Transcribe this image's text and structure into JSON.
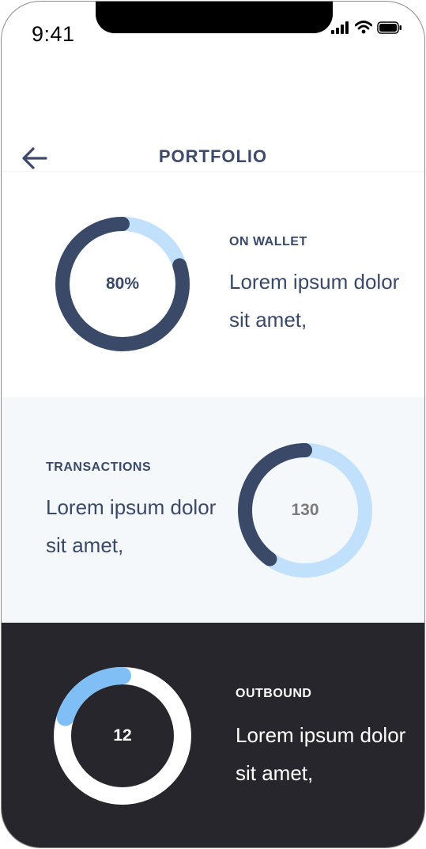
{
  "status_bar": {
    "time": "9:41",
    "icons": [
      "cellular-signal-icon",
      "wifi-icon",
      "battery-icon"
    ]
  },
  "header": {
    "title": "PORTFOLIO",
    "back_icon": "arrow-left-icon"
  },
  "cards": {
    "wallet": {
      "label": "ON WALLET",
      "text": "Lorem ipsum dolor sit amet,",
      "value": "80%",
      "progress": 0.8,
      "track_color": "#c1e0fb",
      "fill_color": "#3a4968",
      "value_color": "#3a4968",
      "text_color": "#3a4968"
    },
    "transactions": {
      "label": "TRANSACTIONS",
      "text": "Lorem ipsum dolor sit amet,",
      "value": "130",
      "progress": 0.4,
      "track_color": "#c1e0fb",
      "fill_color": "#3a4968",
      "value_color": "#7a7a7a",
      "text_color": "#3a4968"
    },
    "outbound": {
      "label": "OUTBOUND",
      "text": "Lorem ipsum dolor sit amet,",
      "value": "12",
      "progress": 0.2,
      "track_color": "#ffffff",
      "fill_color": "#7fbff5",
      "value_color": "#ffffff",
      "text_color": "#ffffff"
    }
  },
  "colors": {
    "title": "#3d4a6a",
    "section_light": "#f4f8fb",
    "section_dark": "#27262d"
  }
}
